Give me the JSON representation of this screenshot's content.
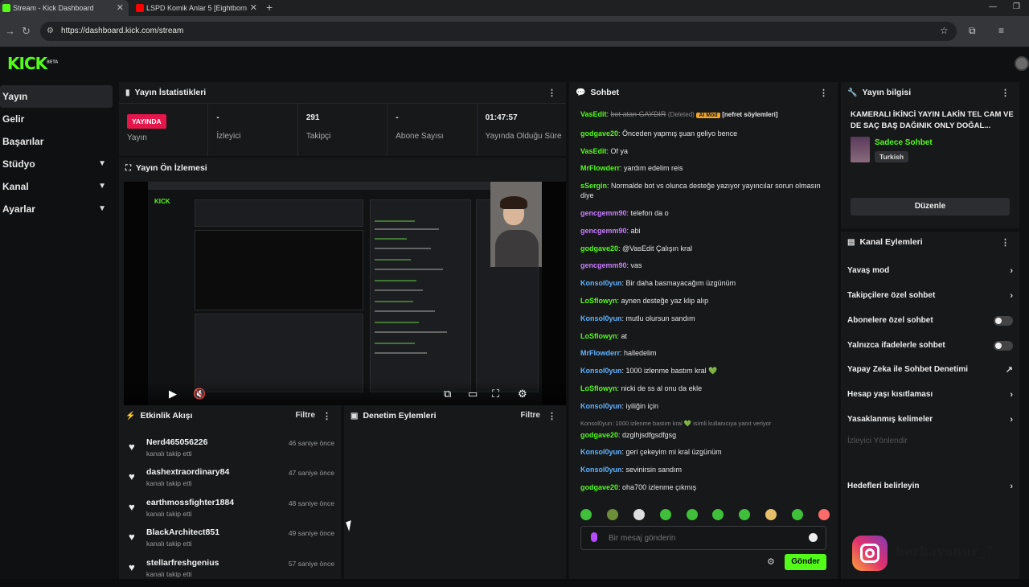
{
  "browser": {
    "tabs": [
      {
        "title": "Stream - Kick Dashboard",
        "favicon_color": "#53fc18",
        "active": true
      },
      {
        "title": "LSPD Komik Anlar 5 [Eightborn",
        "favicon_color": "#ff0000",
        "active": false
      }
    ],
    "url": "https://dashboard.kick.com/stream"
  },
  "app": {
    "logo": "KICK",
    "logo_sup": "BETA",
    "accent": "#53fc18"
  },
  "sidebar": {
    "items": [
      {
        "label": "Yayın",
        "active": true,
        "has_chevron": false
      },
      {
        "label": "Gelir",
        "active": false,
        "has_chevron": false
      },
      {
        "label": "Başarılar",
        "active": false,
        "has_chevron": false
      },
      {
        "label": "Stüdyo",
        "active": false,
        "has_chevron": true
      },
      {
        "label": "Kanal",
        "active": false,
        "has_chevron": true
      },
      {
        "label": "Ayarlar",
        "active": false,
        "has_chevron": true
      }
    ]
  },
  "stats_panel": {
    "title": "Yayın İstatistikleri",
    "live_badge": "YAYINDA",
    "stats": [
      {
        "value": "",
        "label": "Yayın"
      },
      {
        "value": "-",
        "label": "İzleyici"
      },
      {
        "value": "291",
        "label": "Takipçi"
      },
      {
        "value": "-",
        "label": "Abone Sayısı"
      },
      {
        "value": "01:47:57",
        "label": "Yayında Olduğu Süre"
      }
    ]
  },
  "preview_panel": {
    "title": "Yayın Ön İzlemesi",
    "mini_logo": "KICK"
  },
  "activity_panel": {
    "title": "Etkinlik Akışı",
    "filter": "Filtre",
    "items": [
      {
        "name": "Nerd465056226",
        "action": "kanalı takip etti",
        "ago": "46 saniye önce"
      },
      {
        "name": "dashextraordinary84",
        "action": "kanalı takip etti",
        "ago": "47 saniye önce"
      },
      {
        "name": "earthmossfighter1884",
        "action": "kanalı takip etti",
        "ago": "48 saniye önce"
      },
      {
        "name": "BlackArchitect851",
        "action": "kanalı takip etti",
        "ago": "49 saniye önce"
      },
      {
        "name": "stellarfreshgenius",
        "action": "kanalı takip etti",
        "ago": "57 saniye önce"
      }
    ]
  },
  "moderation_panel": {
    "title": "Denetim Eylemleri",
    "filter": "Filtre"
  },
  "chat": {
    "title": "Sohbet",
    "messages": [
      {
        "user": "VasEdit",
        "color": "#53fc18",
        "text": "bot atan GAYDIR",
        "deleted": "(Deleted)",
        "badge": "AI Mod",
        "tag": "[nefret söylemleri]"
      },
      {
        "user": "godgave20",
        "color": "#53fc18",
        "text": "Önceden yapmış şuan geliyo bence"
      },
      {
        "user": "VasEdit",
        "color": "#53fc18",
        "text": "Of ya"
      },
      {
        "user": "MrFlowderr",
        "color": "#53fc18",
        "text": "yardım edelim reis"
      },
      {
        "user": "sSergin",
        "color": "#53fc18",
        "text": "Normalde bot vs olunca desteğe yazıyor yayıncılar sorun olmasın diye"
      },
      {
        "user": "gencgemm90",
        "color": "#c77dff",
        "text": "telefon da o"
      },
      {
        "user": "gencgemm90",
        "color": "#c77dff",
        "text": "abi"
      },
      {
        "user": "godgave20",
        "color": "#53fc18",
        "text": "@VasEdit Çalışın kral"
      },
      {
        "user": "gencgemm90",
        "color": "#c77dff",
        "text": "vas"
      },
      {
        "user": "Konsol0yun",
        "color": "#5eb3ff",
        "text": "Bir daha basmayacağım üzgünüm"
      },
      {
        "user": "LoSflowyn",
        "color": "#53fc18",
        "text": "aynen desteğe yaz klip alıp"
      },
      {
        "user": "Konsol0yun",
        "color": "#5eb3ff",
        "text": "mutlu olursun sandım"
      },
      {
        "user": "LoSflowyn",
        "color": "#53fc18",
        "text": "at"
      },
      {
        "user": "MrFlowderr",
        "color": "#5eb3ff",
        "text": "halledelim"
      },
      {
        "user": "Konsol0yun",
        "color": "#5eb3ff",
        "text": "1000 izlenme bastım kral 💚"
      },
      {
        "user": "LoSflowyn",
        "color": "#53fc18",
        "text": "nicki de ss al onu da ekle"
      },
      {
        "user": "Konsol0yun",
        "color": "#5eb3ff",
        "text": "iyiliğin için"
      },
      {
        "reply": "Konsol0yun: 1000 izlenme bastım kral 💚 isimli kullanıcıya yanıt veriyor",
        "user": "godgave20",
        "color": "#53fc18",
        "text": "dzglhjsdfgsdfgsg"
      },
      {
        "user": "Konsol0yun",
        "color": "#5eb3ff",
        "text": "geri çekeyim mi kral üzgünüm"
      },
      {
        "user": "Konsol0yun",
        "color": "#5eb3ff",
        "text": "sevinirsin sandım"
      },
      {
        "user": "godgave20",
        "color": "#53fc18",
        "text": "oha700 izlenme çıkmış"
      }
    ],
    "input_placeholder": "Bir mesaj gönderin",
    "send_label": "Gönder"
  },
  "stream_info": {
    "title": "Yayın bilgisi",
    "stream_title": "KAMERALI İKİNCİ YAYIN LAKİN TEL CAM VE DE SAÇ BAŞ DAĞINIK ONLY DOĞAL...",
    "category": "Sadece Sohbet",
    "language": "Turkish",
    "edit_label": "Düzenle"
  },
  "channel_actions": {
    "title": "Kanal Eylemleri",
    "items": [
      {
        "label": "Yavaş mod",
        "control": "chevron"
      },
      {
        "label": "Takipçilere özel sohbet",
        "control": "chevron"
      },
      {
        "label": "Abonelere özel sohbet",
        "control": "toggle"
      },
      {
        "label": "Yalnızca ifadelerle sohbet",
        "control": "toggle"
      },
      {
        "label": "Yapay Zeka ile Sohbet Denetimi",
        "control": "external"
      },
      {
        "label": "Hesap yaşı kısıtlaması",
        "control": "chevron"
      },
      {
        "label": "Yasaklanmış kelimeler",
        "control": "chevron"
      },
      {
        "label": "İzleyici Yönlendir",
        "control": "none",
        "disabled": true
      },
      {
        "label": "Hedefleri belirleyin",
        "control": "chevron"
      }
    ]
  },
  "overlay": {
    "handle": "berkayonur_7"
  }
}
